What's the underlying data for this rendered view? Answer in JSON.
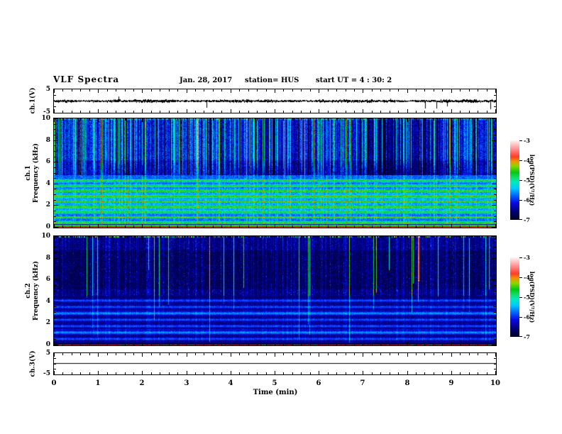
{
  "header": {
    "title": "VLF Spectra",
    "date": "Jan. 28, 2017",
    "station": "station= HUS",
    "start_ut": "start UT =  4 : 30: 2"
  },
  "time_axis": {
    "label": "Time (min)",
    "range": [
      0,
      10
    ],
    "ticks": [
      0,
      1,
      2,
      3,
      4,
      5,
      6,
      7,
      8,
      9,
      10
    ],
    "minor_step": 0.2
  },
  "panels": {
    "ch1_wave": {
      "ylabel": "ch.1(V)",
      "yticks": [
        5,
        -5
      ],
      "minor_yticks": [
        2.5,
        0,
        -2.5
      ],
      "ylim": [
        -5,
        5
      ]
    },
    "ch1_spec": {
      "ylabel_line1": "ch.1",
      "ylabel_line2": "Frequency (kHz)",
      "yticks": [
        10,
        8,
        6,
        4,
        2,
        0
      ],
      "minor_step": 0.5,
      "ylim": [
        0,
        10
      ]
    },
    "ch2_spec": {
      "ylabel_line1": "ch.2",
      "ylabel_line2": "Frequency (kHz)",
      "yticks": [
        10,
        8,
        6,
        4,
        2,
        0
      ],
      "minor_step": 0.5,
      "ylim": [
        0,
        10
      ]
    },
    "ch3_wave": {
      "ylabel": "ch.3(V)",
      "yticks": [
        5,
        -5
      ],
      "minor_yticks": [
        2.5,
        0,
        -2.5
      ],
      "ylim": [
        -5,
        5
      ]
    }
  },
  "colorbar": {
    "label": "log(PSD)(V²/Hz)",
    "ticks": [
      -3,
      -4,
      -5,
      -6,
      -7
    ],
    "range": [
      -7,
      -3
    ],
    "gradient_stops": [
      {
        "pos": 0.0,
        "color": "#00001e"
      },
      {
        "pos": 0.1,
        "color": "#00006e"
      },
      {
        "pos": 0.22,
        "color": "#0a0ae6"
      },
      {
        "pos": 0.32,
        "color": "#006eff"
      },
      {
        "pos": 0.4,
        "color": "#00c8ff"
      },
      {
        "pos": 0.48,
        "color": "#00ebbe"
      },
      {
        "pos": 0.54,
        "color": "#14dc64"
      },
      {
        "pos": 0.6,
        "color": "#00c814"
      },
      {
        "pos": 0.68,
        "color": "#8cd700"
      },
      {
        "pos": 0.74,
        "color": "#f09600"
      },
      {
        "pos": 0.8,
        "color": "#ff3c28"
      },
      {
        "pos": 0.88,
        "color": "#ff8282"
      },
      {
        "pos": 1.0,
        "color": "#fff0f0"
      }
    ]
  },
  "chart_data": [
    {
      "type": "line",
      "name": "ch1_waveform",
      "ylabel": "ch.1(V)",
      "xlim": [
        0,
        10
      ],
      "ylim": [
        -5,
        5
      ],
      "description": "Broadband noise trace centered on 0 V, amplitude roughly ±0.5 V, with sporadic impulsive spikes reaching about ±3 V throughout the 10 minutes"
    },
    {
      "type": "heatmap",
      "name": "ch1_spectrogram",
      "ylabel": "ch.1 Frequency (kHz)",
      "xlim": [
        0,
        10
      ],
      "ylim": [
        0,
        10
      ],
      "colorbar_range": [
        -7,
        -3
      ],
      "sferic_region_khz": [
        4.8,
        10
      ],
      "harmonic_band_top_khz": 4.5,
      "harmonic_band_period_khz": 0.48,
      "green_line_khz": 0.2,
      "red_line_khz": 0.06,
      "description": "Dense vertical sferic streaks (blue/cyan/green) above ~4.8 kHz over a dark-blue background; strong alternating horizontal harmonic bands (cyan-green over blue) below ~4.5 kHz; narrow green line near 0.2 kHz and red line just above 0 kHz"
    },
    {
      "type": "heatmap",
      "name": "ch2_spectrogram",
      "ylabel": "ch.2 Frequency (kHz)",
      "xlim": [
        0,
        10
      ],
      "ylim": [
        0,
        10
      ],
      "colorbar_range": [
        -7,
        -3
      ],
      "sferic_region_khz": [
        4.5,
        10
      ],
      "harmonic_band_top_khz": 4.3,
      "harmonic_band_period_khz": 0.585,
      "red_line_khz": 0.05,
      "description": "Much darker channel: sparse faint blue vertical streaks with occasional bright cyan/green sferic lines above ~4.5 kHz on a near-black background; dim blue horizontal harmonic bands below ~4.3 kHz; continuous red baseline at 0 kHz with green speckles"
    },
    {
      "type": "line",
      "name": "ch3_waveform",
      "ylabel": "ch.3(V)",
      "xlim": [
        0,
        10
      ],
      "ylim": [
        -5,
        5
      ],
      "description": "Flat line at 0 V (channel inactive)"
    }
  ]
}
